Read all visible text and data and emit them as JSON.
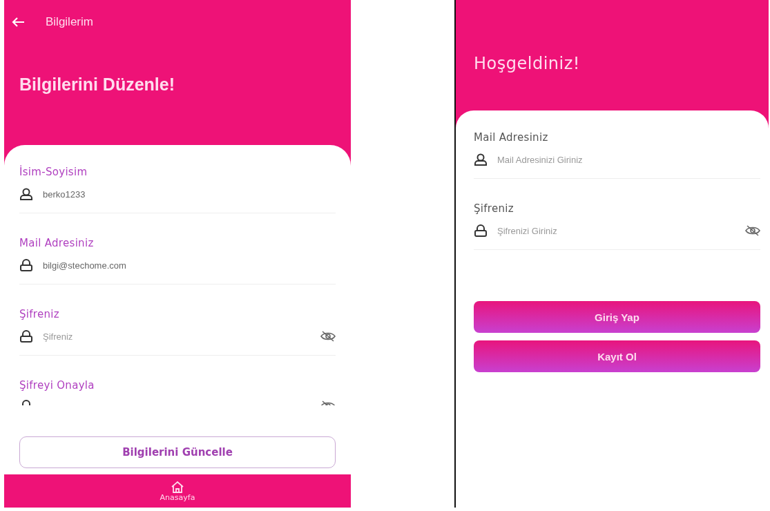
{
  "edit_screen": {
    "app_bar": {
      "title": "Bilgilerim"
    },
    "heading": "Bilgilerini Düzenle!",
    "fields": [
      {
        "label": "İsim-Soyisim",
        "kind": "user",
        "value": "berko1233"
      },
      {
        "label": "Mail Adresiniz",
        "kind": "locked",
        "value": "bilgi@stechome.com"
      },
      {
        "label": "Şifreniz",
        "kind": "password",
        "placeholder": "Şifreniz"
      },
      {
        "label": "Şifreyi Onayla",
        "kind": "password"
      }
    ],
    "update_button": "Bilgilerini Güncelle",
    "bottom_nav": {
      "label": "Anasayfa"
    }
  },
  "login_screen": {
    "heading": "Hoşgeldiniz!",
    "fields": [
      {
        "label": "Mail Adresiniz",
        "kind": "user",
        "placeholder": "Mail Adresinizi Giriniz"
      },
      {
        "label": "Şifreniz",
        "kind": "password",
        "placeholder": "Şifrenizi Giriniz"
      }
    ],
    "buttons": [
      "Giriş Yap",
      "Kayıt Ol"
    ]
  }
}
